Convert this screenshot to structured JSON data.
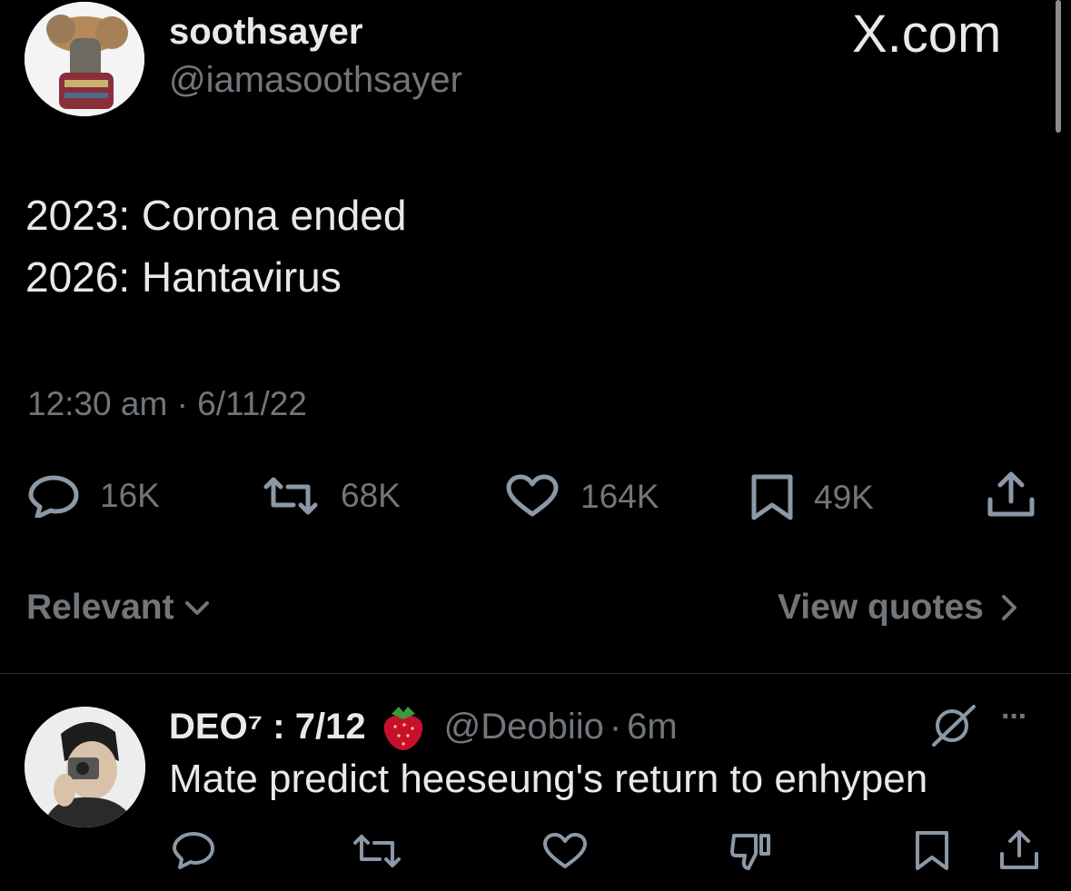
{
  "watermark": "X.com",
  "tweet": {
    "author": {
      "name": "soothsayer",
      "handle": "@iamasoothsayer"
    },
    "lines": [
      "2023: Corona ended",
      "2026: Hantavirus"
    ],
    "time": "12:30 am",
    "separator": "·",
    "date": "6/11/22",
    "stats": {
      "replies": "16K",
      "retweets": "68K",
      "likes": "164K",
      "bookmarks": "49K"
    }
  },
  "replies_bar": {
    "sort_label": "Relevant",
    "view_quotes_label": "View quotes"
  },
  "reply": {
    "name": "DEO⁷ : 7/12",
    "emoji": "🍓",
    "handle": "@Deobiio",
    "separator": "·",
    "age": "6m",
    "more": "···",
    "text": "Mate predict heeseung's return to enhypen"
  },
  "icons": {
    "reply": "speech-bubble-icon",
    "retweet": "retweet-icon",
    "like": "heart-icon",
    "bookmark": "bookmark-icon",
    "share": "share-icon",
    "dislike": "thumbs-down-icon",
    "grok": "grok-slash-icon"
  },
  "colors": {
    "background": "#000000",
    "text": "#e7e9ea",
    "muted": "#71767b",
    "divider": "#2f3336"
  }
}
